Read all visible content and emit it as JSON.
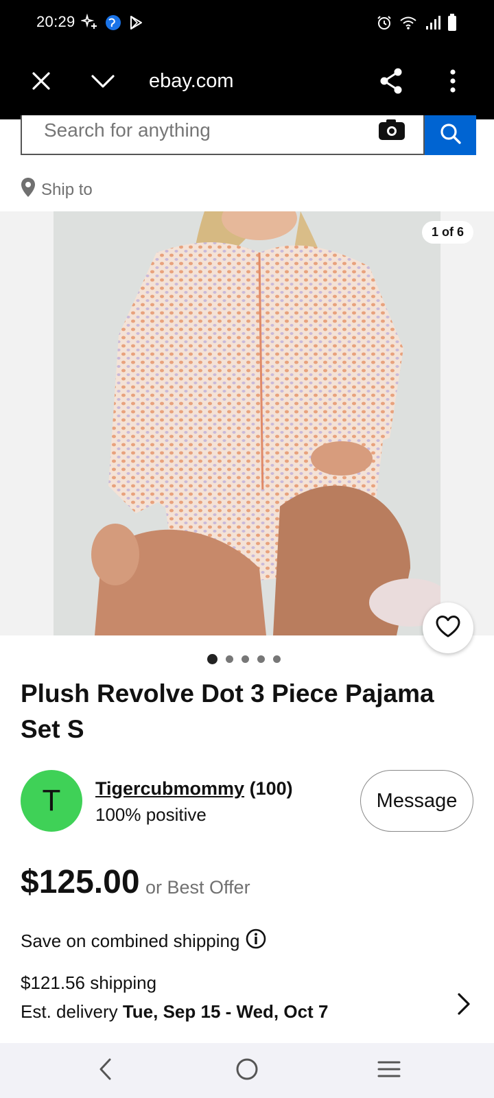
{
  "status_bar": {
    "time": "20:29",
    "left_icons": [
      "sparkle-icon",
      "globe-icon",
      "play-store-icon"
    ],
    "right_icons": [
      "alarm-icon",
      "wifi-icon",
      "signal-icon",
      "battery-icon"
    ]
  },
  "browser": {
    "url": "ebay.com",
    "icons": [
      "close-icon",
      "chevron-down-icon",
      "share-icon",
      "more-vertical-icon"
    ]
  },
  "search": {
    "placeholder": "Search for anything",
    "icons": [
      "camera-icon",
      "search-icon"
    ],
    "accent_color": "#0064d2"
  },
  "ship_to": {
    "label": "Ship to"
  },
  "gallery": {
    "counter": "1 of 6",
    "dot_count": 5,
    "active_dot": 0
  },
  "listing": {
    "title": "Plush Revolve Dot 3 Piece Pajama Set S",
    "price": "$125.00",
    "best_offer": "or Best Offer",
    "combined_shipping": "Save on combined shipping",
    "shipping_cost": "$121.56 shipping",
    "delivery_label": "Est. delivery",
    "delivery_dates": "Tue, Sep 15 - Wed, Oct 7"
  },
  "seller": {
    "initial": "T",
    "name": "Tigercubmommy",
    "score": "(100)",
    "positive": "100% positive",
    "avatar_color": "#3fd157",
    "message_label": "Message"
  },
  "nav_bar": {
    "icons": [
      "back-icon",
      "home-icon",
      "recents-icon"
    ]
  }
}
